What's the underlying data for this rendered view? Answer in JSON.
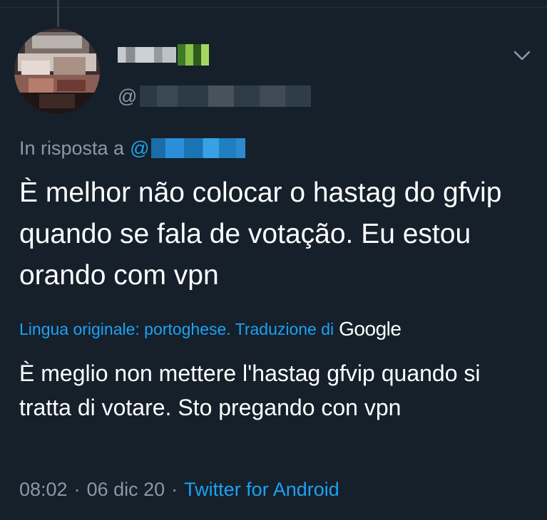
{
  "tweet": {
    "handle_prefix": "@",
    "reply": {
      "label": "In risposta a",
      "at": "@"
    },
    "text": "È melhor não colocar o hastag do gfvip quando se fala de votação. Eu estou orando com vpn",
    "translation": {
      "label": "Lingua originale: portoghese. Traduzione di",
      "provider": "Google",
      "text": "È meglio non mettere l'hastag gfvip quando si tratta di votare. Sto pregando con vpn"
    },
    "meta": {
      "time": "08:02",
      "separator1": "·",
      "date": "06 dic 20",
      "separator2": "·",
      "source": "Twitter for Android"
    }
  },
  "icons": {
    "menu": "chevron-down-icon"
  },
  "colors": {
    "background": "#15202b",
    "muted": "#8899a6",
    "accent": "#1da1f2",
    "text": "#ffffff"
  }
}
